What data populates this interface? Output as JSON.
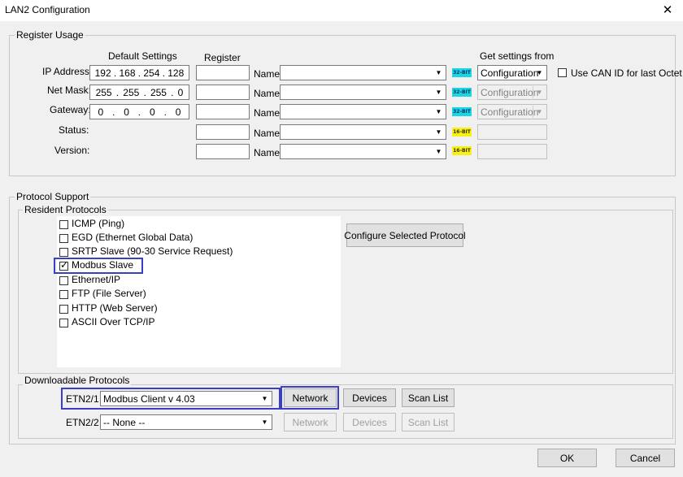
{
  "window": {
    "title": "LAN2 Configuration",
    "close": "✕"
  },
  "register_usage": {
    "title": "Register Usage",
    "col_default": "Default Settings",
    "col_register": "Register",
    "col_get": "Get settings from",
    "name_label": "Name:",
    "use_can_id": "Use CAN ID for last Octet",
    "rows": [
      {
        "label": "IP Address:",
        "octets": [
          "192",
          "168",
          "254",
          "128"
        ],
        "badge": "32-BIT",
        "source": "Configuration"
      },
      {
        "label": "Net Mask:",
        "octets": [
          "255",
          "255",
          "255",
          "0"
        ],
        "badge": "32-BIT",
        "source": "Configuration"
      },
      {
        "label": "Gateway:",
        "octets": [
          "0",
          "0",
          "0",
          "0"
        ],
        "badge": "32-BIT",
        "source": "Configuration"
      },
      {
        "label": "Status:",
        "badge": "16-BIT"
      },
      {
        "label": "Version:",
        "badge": "16-BIT"
      }
    ]
  },
  "protocol_support": {
    "title": "Protocol Support",
    "resident_title": "Resident Protocols",
    "protocols": [
      {
        "label": "ICMP (Ping)",
        "checked": false
      },
      {
        "label": "EGD (Ethernet Global Data)",
        "checked": false
      },
      {
        "label": "SRTP Slave (90-30 Service Request)",
        "checked": false
      },
      {
        "label": "Modbus Slave",
        "checked": true
      },
      {
        "label": "Ethernet/IP",
        "checked": false
      },
      {
        "label": "FTP (File Server)",
        "checked": false
      },
      {
        "label": "HTTP (Web Server)",
        "checked": false
      },
      {
        "label": "ASCII Over TCP/IP",
        "checked": false
      }
    ],
    "configure_btn": "Configure Selected Protocol",
    "checkmark": "✓",
    "downloadable_title": "Downloadable Protocols",
    "slots": [
      {
        "label": "ETN2/1",
        "value": "Modbus Client  v 4.03",
        "network": "Network",
        "devices": "Devices",
        "scan": "Scan List"
      },
      {
        "label": "ETN2/2",
        "value": "-- None --",
        "network": "Network",
        "devices": "Devices",
        "scan": "Scan List"
      }
    ]
  },
  "buttons": {
    "ok": "OK",
    "cancel": "Cancel"
  },
  "icons": {
    "dropdown": "▼"
  }
}
